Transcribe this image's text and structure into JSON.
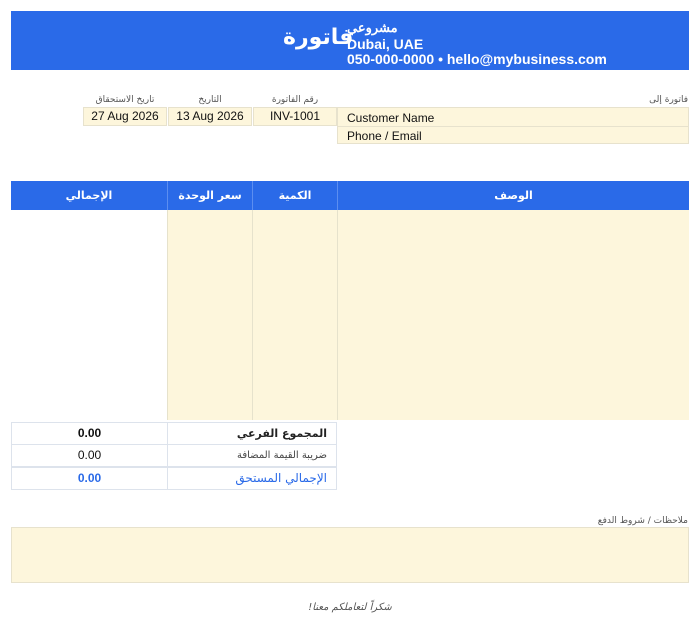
{
  "header": {
    "title": "فاتورة",
    "business_name": "مشروعي",
    "location": "Dubai, UAE",
    "contact": "050-000-0000  •  hello@mybusiness.com"
  },
  "bill_to": {
    "label": "فاتورة إلى",
    "customer_name": "Customer Name",
    "phone_email": "Phone / Email"
  },
  "meta": {
    "invoice_number_label": "رقم الفاتورة",
    "invoice_number": "INV-1001",
    "date_label": "التاريخ",
    "date": "13 Aug 2026",
    "due_date_label": "تاريخ الاستحقاق",
    "due_date": "27 Aug 2026"
  },
  "table": {
    "columns": {
      "description": "الوصف",
      "quantity": "الكمية",
      "unit_price": "سعر الوحدة",
      "total": "الإجمالي"
    },
    "row_count": 10
  },
  "summary": {
    "subtotal_label": "المجموع الفرعي",
    "subtotal": "0.00",
    "vat_label": "ضريبة القيمة المضافة",
    "vat": "0.00",
    "total_due_label": "الإجمالي المستحق",
    "total_due": "0.00"
  },
  "notes": {
    "label": "ملاحظات / شروط الدفع"
  },
  "footer": {
    "thanks": "شكراً لتعاملكم معنا!"
  },
  "colors": {
    "accent": "#2a6ae8",
    "input_fill": "#fdf6dc"
  }
}
